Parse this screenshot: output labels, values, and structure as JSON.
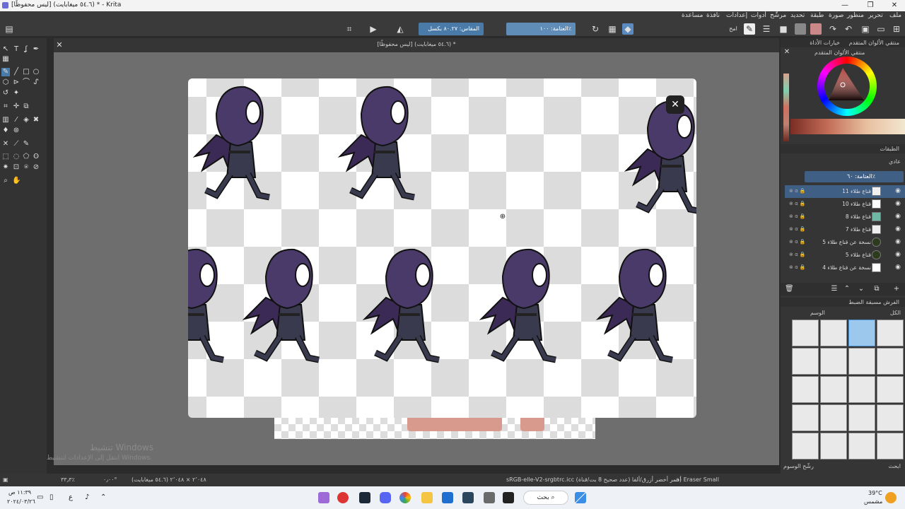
{
  "window": {
    "title": "[ليس محفوظًا] (٥٤.٦ ميغابايت) * - Krita",
    "minimize": "—",
    "maximize": "❐",
    "close": "✕"
  },
  "menu": [
    "ملف",
    "تحرير",
    "منظور",
    "صورة",
    "طبقة",
    "تحديد",
    "مرشّح",
    "أدوات",
    "إعدادات",
    "نافذة",
    "مساعدة"
  ],
  "toolbar": {
    "opacity_field": "العتامة: ١٠٠٪",
    "scale_field": "المقاس: ٨٠.٢٧ بكسل",
    "erase_label": "امح"
  },
  "document_tab": {
    "title": "[ليس محفوظًا] (٥٤.٦ ميغابايت) *"
  },
  "image_viewer": {
    "close": "✕"
  },
  "activation_watermark": {
    "line1": "تنشيط Windows",
    "line2": "انتقل إلى الإعدادات لتنشيط Windows."
  },
  "right_dock": {
    "tool_options_tab": "خيارات الأداة",
    "color_selector_tab": "منتقي الألوان المتقدم",
    "color_selector_title": "منتقي الألوان المتقدم",
    "layers_title": "الطبقات",
    "blend_mode": "عادي",
    "layer_opacity": "العتامة: ٦٠٪",
    "layers": [
      {
        "name": "قناع طلاء 11",
        "thumb": "#f0f0f0"
      },
      {
        "name": "قناع طلاء 10",
        "thumb": "#ffffff"
      },
      {
        "name": "قناع طلاء 8",
        "thumb": "#6fb8a8"
      },
      {
        "name": "قناع طلاء 7",
        "thumb": "#eeeeee"
      },
      {
        "name": "نسخة عن قناع طلاء 5",
        "thumb": "#2c3b1e"
      },
      {
        "name": "قناع طلاء 5",
        "thumb": "#2c3b1e"
      },
      {
        "name": "نسخة عن قناع طلاء 4",
        "thumb": "#ffffff"
      }
    ],
    "brush_presets_title": "الفرش مسبقة الضبط",
    "brush_tag_all": "الكل",
    "brush_tag_label": "الوسم",
    "brush_filter_label": "رشّح الوسوم",
    "brush_search_label": "ابحث"
  },
  "statusbar": {
    "brush": "a) Eraser Small",
    "colorspace": "sRGB-elle-V2-srgbtrc.icc (أحمر أخضر أزرق/ألفا (عدد صحيح 8 بت/قناة",
    "dims": "٢٬٠٤٨ × ٢٬٠٤٨ (٥٤.٦ ميغابايت)",
    "rotation": "٠٫٠٠°",
    "zoom": "٣٣٫٣٪"
  },
  "taskbar": {
    "search": "بحث",
    "time": "١١:٣٩ ص",
    "date": "٢٠٢٤/٠٣/٢٦",
    "weather_temp": "39°C",
    "weather_text": "مشمس",
    "lang": "ع"
  }
}
